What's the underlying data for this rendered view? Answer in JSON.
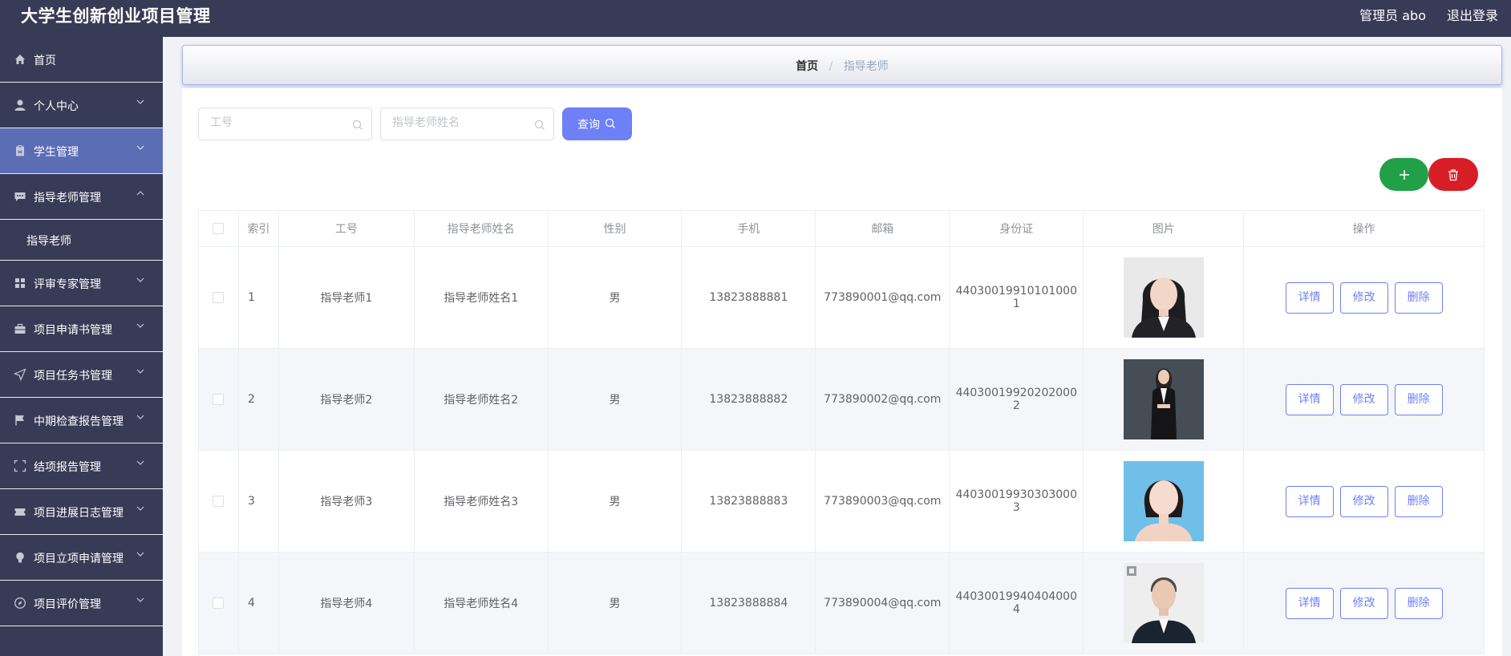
{
  "header": {
    "title": "大学生创新创业项目管理",
    "user": "管理员 abo",
    "logout": "退出登录"
  },
  "sidebar": {
    "items": [
      {
        "label": "首页",
        "icon": "home-icon"
      },
      {
        "label": "个人中心",
        "icon": "user-icon"
      },
      {
        "label": "学生管理",
        "icon": "clipboard-icon"
      },
      {
        "label": "指导老师管理",
        "icon": "chat-icon"
      },
      {
        "label": "评审专家管理",
        "icon": "grid-icon"
      },
      {
        "label": "项目申请书管理",
        "icon": "briefcase-icon"
      },
      {
        "label": "项目任务书管理",
        "icon": "send-icon"
      },
      {
        "label": "中期检查报告管理",
        "icon": "flag-icon"
      },
      {
        "label": "结项报告管理",
        "icon": "fullscreen-icon"
      },
      {
        "label": "项目进展日志管理",
        "icon": "ticket-icon"
      },
      {
        "label": "项目立项申请管理",
        "icon": "bulb-icon"
      },
      {
        "label": "项目评价管理",
        "icon": "compass-icon"
      }
    ],
    "subitem": "指导老师"
  },
  "breadcrumb": {
    "home": "首页",
    "separator": "/",
    "current": "指导老师"
  },
  "search": {
    "field1_placeholder": "工号",
    "field1_value": "",
    "field2_placeholder": "指导老师姓名",
    "field2_value": "",
    "query_label": "查询"
  },
  "table": {
    "headers": [
      "索引",
      "工号",
      "指导老师姓名",
      "性别",
      "手机",
      "邮箱",
      "身份证",
      "图片",
      "操作"
    ],
    "actions": {
      "detail": "详情",
      "edit": "修改",
      "delete": "删除"
    },
    "rows": [
      {
        "index": "1",
        "id": "指导老师1",
        "name": "指导老师姓名1",
        "gender": "男",
        "phone": "13823888881",
        "email": "773890001@qq.com",
        "idcard_1": "44030019910101000",
        "idcard_2": "1"
      },
      {
        "index": "2",
        "id": "指导老师2",
        "name": "指导老师姓名2",
        "gender": "男",
        "phone": "13823888882",
        "email": "773890002@qq.com",
        "idcard_1": "44030019920202000",
        "idcard_2": "2"
      },
      {
        "index": "3",
        "id": "指导老师3",
        "name": "指导老师姓名3",
        "gender": "男",
        "phone": "13823888883",
        "email": "773890003@qq.com",
        "idcard_1": "44030019930303000",
        "idcard_2": "3"
      },
      {
        "index": "4",
        "id": "指导老师4",
        "name": "指导老师姓名4",
        "gender": "男",
        "phone": "13823888884",
        "email": "773890004@qq.com",
        "idcard_1": "44030019940404000",
        "idcard_2": "4"
      }
    ]
  },
  "colors": {
    "sidebar_bg": "#383b55",
    "sidebar_active": "#5b6db5",
    "primary": "#6d80f6",
    "add_green": "#21a047",
    "delete_red": "#d71e26"
  }
}
